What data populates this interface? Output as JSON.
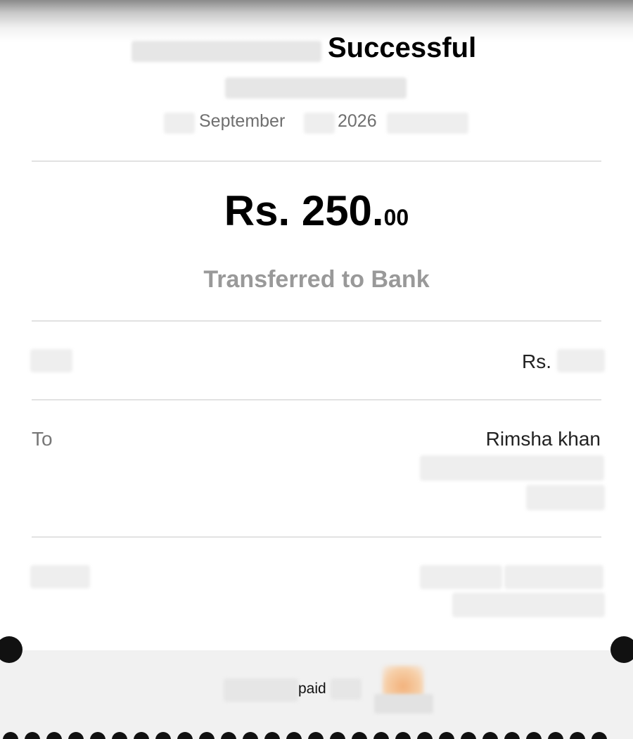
{
  "header": {
    "title": "Successful",
    "date_month": "September",
    "date_year": "2026"
  },
  "transaction": {
    "currency": "Rs.",
    "amount_main": "Rs. 250.",
    "amount_cents": "00",
    "type_label": "Transferred to Bank"
  },
  "fee_row": {
    "value_prefix": "Rs."
  },
  "recipient": {
    "label": "To",
    "name": "Rimsha khan"
  },
  "footer": {
    "paid_text": "paid"
  }
}
